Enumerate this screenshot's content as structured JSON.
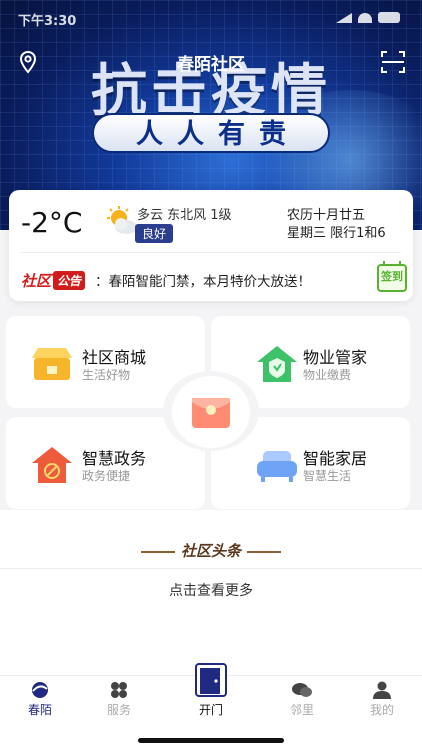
{
  "status_bar": {
    "time": "下午3:30"
  },
  "header": {
    "title": "春陌社区"
  },
  "banner": {
    "headline": "抗击疫情",
    "slogan": "人人有责"
  },
  "weather": {
    "temperature": "-2°C",
    "desc": "多云 东北风 1级",
    "aqi": "良好",
    "lunar": "农历十月廿五",
    "limit": "星期三 限行1和6"
  },
  "notice": {
    "logo_a": "社区",
    "logo_b": "公告",
    "text": "：春陌智能门禁，本月特价大放送！",
    "signin": "签到"
  },
  "services": [
    {
      "title": "社区商城",
      "sub": "生活好物"
    },
    {
      "title": "物业管家",
      "sub": "物业缴费"
    },
    {
      "title": "智慧政务",
      "sub": "政务便捷"
    },
    {
      "title": "智能家居",
      "sub": "智慧生活"
    }
  ],
  "news": {
    "title": "社区头条",
    "more": "点击查看更多"
  },
  "tabs": [
    {
      "label": "春陌"
    },
    {
      "label": "服务"
    },
    {
      "label": "开门"
    },
    {
      "label": "邻里"
    },
    {
      "label": "我的"
    }
  ],
  "colors": {
    "brand": "#1f2a80",
    "accent_red": "#d21c1c",
    "signin_green": "#58b22f"
  }
}
